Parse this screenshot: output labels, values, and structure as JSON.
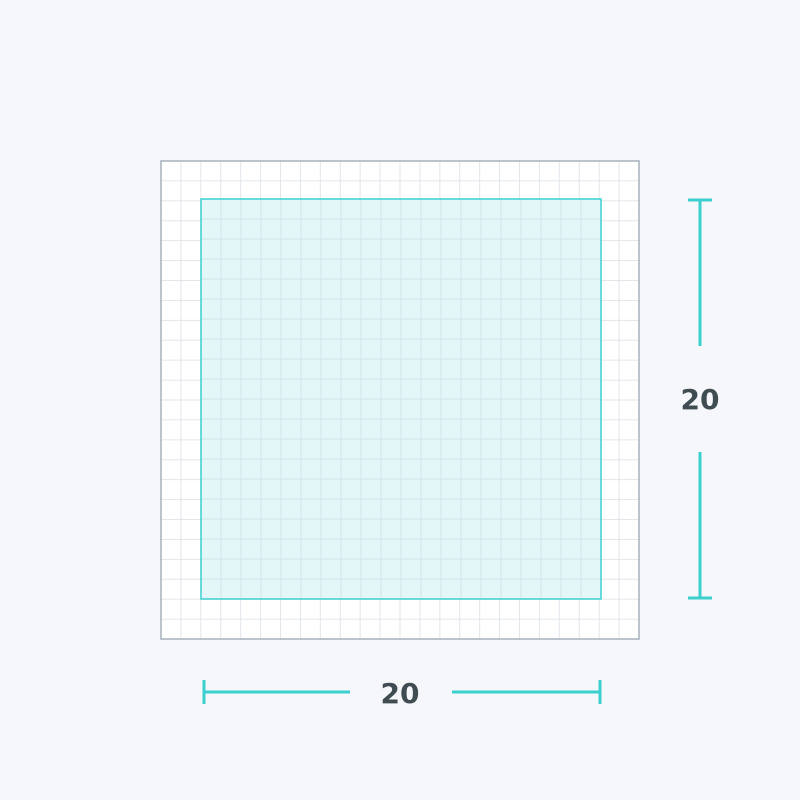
{
  "grid": {
    "outer_cells": 24,
    "inner_cells": 20,
    "colors": {
      "background": "#f5f7fa",
      "grid_fill": "#ffffff",
      "grid_line": "#e2e6ea",
      "outer_border": "#a6b0bc",
      "highlight_fill": "#e3f6f8",
      "highlight_line": "#cfe7ea",
      "accent": "#3ccfcf",
      "label": "#3f4d52"
    }
  },
  "dimensions": {
    "width_label": "20",
    "height_label": "20"
  }
}
